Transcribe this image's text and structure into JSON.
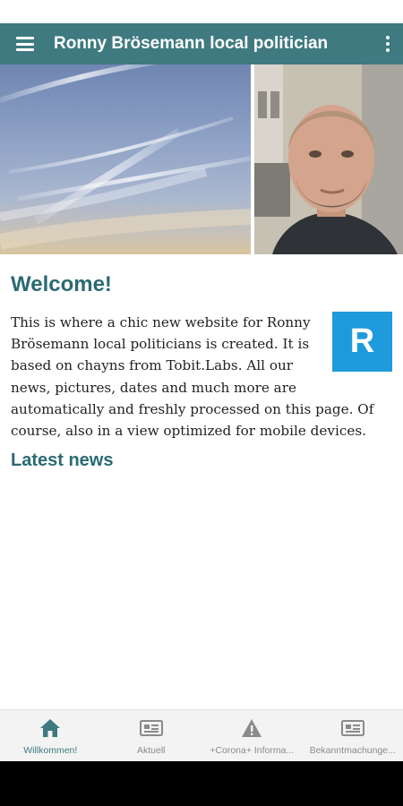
{
  "app": {
    "title": "Ronny Brösemann local politician"
  },
  "colors": {
    "app_bar": "#3f7a80",
    "heading": "#2a6a73",
    "logo_badge": "#1e9bdc",
    "nav_active": "#3f7a80",
    "nav_inactive": "#8a8a8a"
  },
  "logo": {
    "letter": "R"
  },
  "content": {
    "welcome_title": "Welcome!",
    "intro_text": "This is where a chic new website for Ronny Brösemann local politicians is created. It is based on chayns from Tobit.Labs. All our news, pictures, dates and much more are automatically and freshly processed on this page. Of course, also in a view optimized for mobile devices.",
    "latest_news_title": "Latest news"
  },
  "bottom_nav": {
    "items": [
      {
        "label": "Willkommen!",
        "icon": "home-icon",
        "active": true
      },
      {
        "label": "Aktuell",
        "icon": "newspaper-icon",
        "active": false
      },
      {
        "label": "+Corona+ Informa...",
        "icon": "warning-icon",
        "active": false
      },
      {
        "label": "Bekanntmachunge...",
        "icon": "newspaper-icon",
        "active": false
      }
    ]
  }
}
